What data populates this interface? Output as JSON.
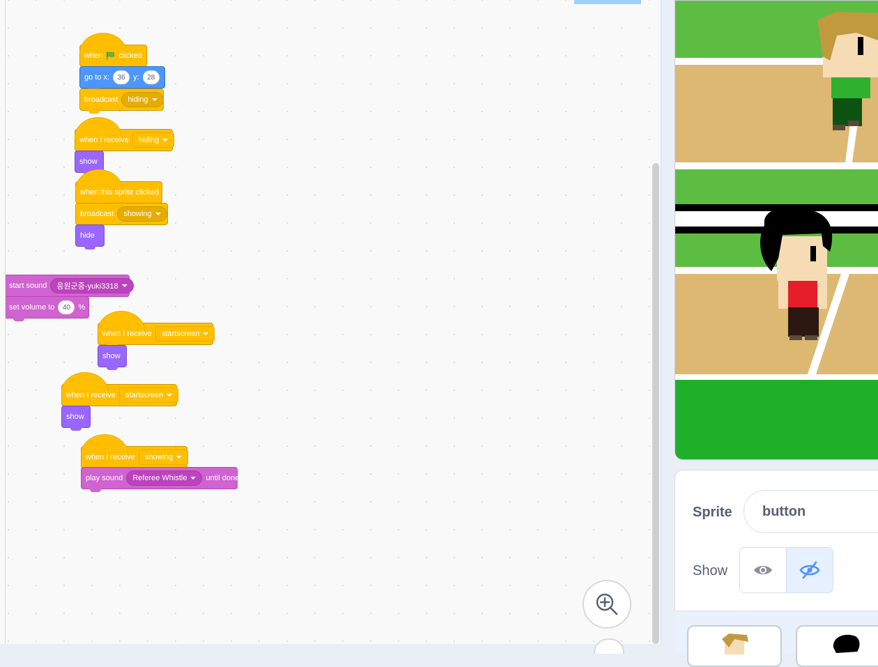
{
  "scripts": {
    "s1": {
      "when": "when",
      "clicked": "clicked",
      "goto": "go to x:",
      "y_label": "y:",
      "x": "36",
      "y": "28",
      "broadcast": "broadcast",
      "msg": "hiding"
    },
    "s2": {
      "receive": "when I receive",
      "msg": "hiding",
      "show": "show"
    },
    "s3": {
      "clicked": "when this sprite clicked",
      "broadcast": "broadcast",
      "msg": "showing",
      "hide": "hide"
    },
    "s4": {
      "start_sound": "start sound",
      "sound": "응원군중-yuki3318",
      "set_volume": "set volume to",
      "volume": "40",
      "percent": "%"
    },
    "s5": {
      "receive": "when I receive",
      "msg": "startscreen",
      "show": "show"
    },
    "s6": {
      "receive": "when I receive",
      "msg": "startscreen",
      "show": "show"
    },
    "s7": {
      "receive": "when I receive",
      "msg": "showing",
      "play_sound": "play sound",
      "sound": "Referee Whistle",
      "until_done": "until done"
    }
  },
  "sprite_info": {
    "sprite_label": "Sprite",
    "sprite_name": "button",
    "show_label": "Show"
  },
  "colors": {
    "events": "#ffbf00",
    "motion": "#4c97ff",
    "looks": "#9966ff",
    "sound": "#cf63cf",
    "stage_grass": "#5cbd42",
    "stage_track": "#dcb873"
  },
  "icons": {
    "flag": "green-flag-icon",
    "zoom": "zoom-in-icon",
    "visible": "eye-icon",
    "hidden": "eye-slash-icon"
  }
}
